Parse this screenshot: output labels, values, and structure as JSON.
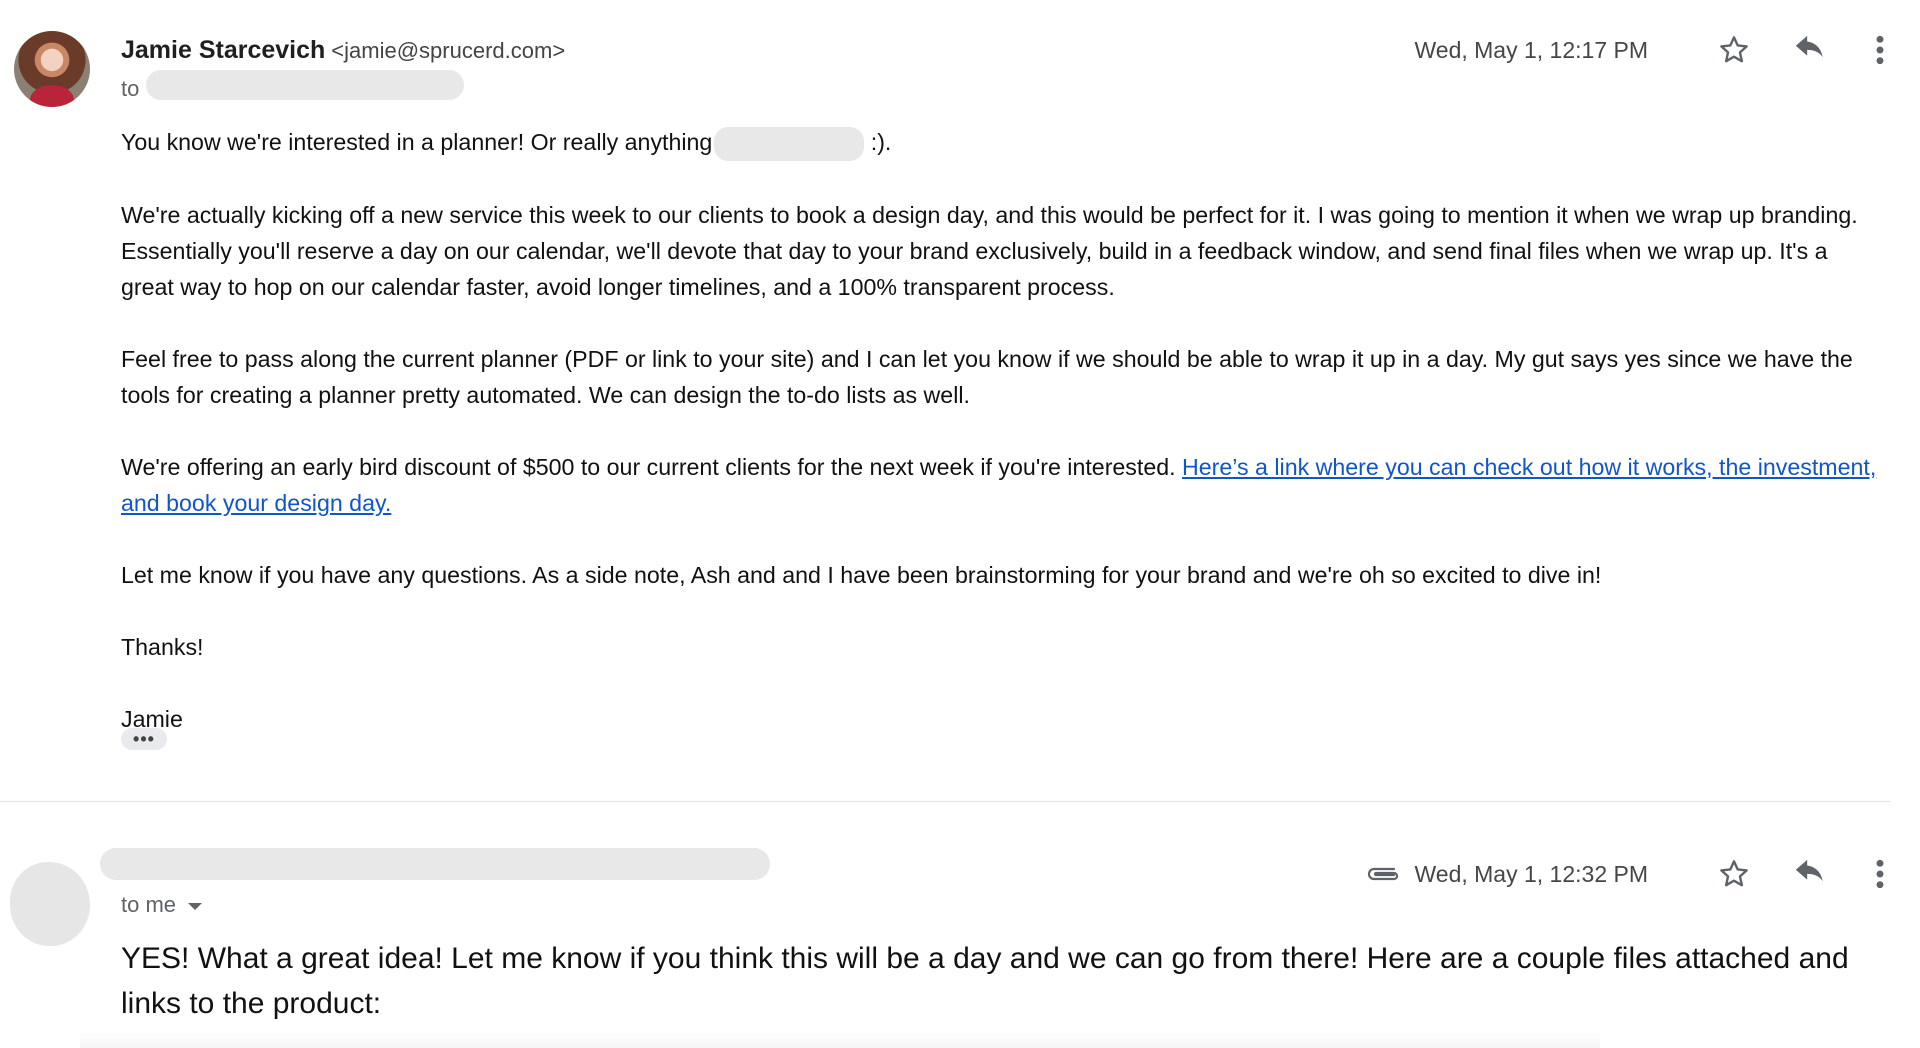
{
  "message1": {
    "sender_name": "Jamie Starcevich",
    "sender_email": "<jamie@sprucerd.com>",
    "to_label": "to",
    "date": "Wed, May 1, 12:17 PM",
    "p1_before": "You know we're interested in a planner! Or really anything",
    "p1_after": " :).",
    "p2": "We're actually kicking off a new service this week to our clients to book a design day, and this would be perfect for it. I was going to mention it when we wrap up branding. Essentially you'll reserve a day on our calendar, we'll devote that day to your brand exclusively, build in a feedback window, and send final files when we wrap up. It's a great way to hop on our calendar faster, avoid longer timelines, and a 100% transparent process.",
    "p3": "Feel free to pass along the current planner (PDF or link to your site) and I can let you know if we should be able to wrap it up in a day. My gut says yes since we have the tools for creating a planner pretty automated. We can design the to-do lists as well.",
    "p4_text": "We're offering an early bird discount of $500 to our current clients for the next week if you're interested. ",
    "p4_link": "Here’s a link where you can check out how it works, the investment, and book your design day.",
    "p5": "Let me know if you have any questions. As a side note, Ash and and I have been brainstorming for your brand and we're oh so excited to dive in!",
    "signoff": "Thanks!",
    "signature": "Jamie",
    "ellipsis": "•••"
  },
  "message2": {
    "to_label": "to me",
    "date": "Wed, May 1, 12:32 PM",
    "body": "YES!  What a great idea!  Let me know if you think this will be a day and we can go from there!  Here are a couple files attached and links to the product:"
  },
  "colors": {
    "link": "#1155cc",
    "redaction": "#e8e8e8",
    "icon": "#5f6368"
  },
  "icons": [
    "star-icon",
    "reply-icon",
    "more-vert-icon",
    "attachment-icon",
    "caret-down-icon"
  ]
}
